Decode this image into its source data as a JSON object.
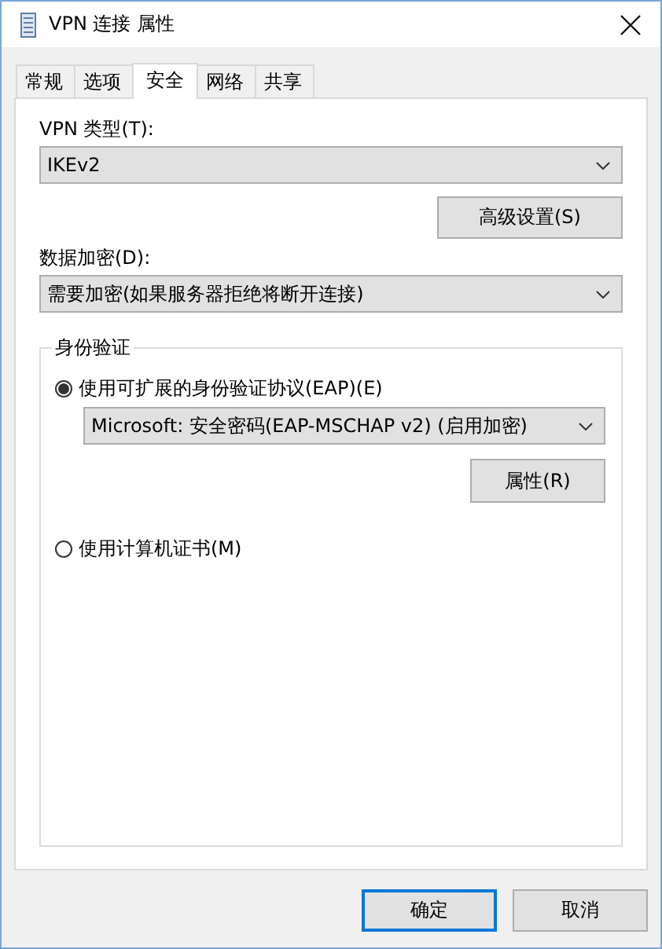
{
  "window": {
    "title": "VPN 连接 属性"
  },
  "tabs": [
    {
      "label": "常规",
      "selected": false
    },
    {
      "label": "选项",
      "selected": false
    },
    {
      "label": "安全",
      "selected": true
    },
    {
      "label": "网络",
      "selected": false
    },
    {
      "label": "共享",
      "selected": false
    }
  ],
  "vpn_type": {
    "label": "VPN 类型(T):",
    "value": "IKEv2"
  },
  "advanced_button": "高级设置(S)",
  "encryption": {
    "label": "数据加密(D):",
    "value": "需要加密(如果服务器拒绝将断开连接)"
  },
  "authentication": {
    "title": "身份验证",
    "options": [
      {
        "label": "使用可扩展的身份验证协议(EAP)(E)",
        "selected": true,
        "method": "Microsoft: 安全密码(EAP-MSCHAP v2) (启用加密)",
        "properties_button": "属性(R)"
      },
      {
        "label": "使用计算机证书(M)",
        "selected": false
      }
    ]
  },
  "buttons": [
    {
      "label": "确定",
      "default": true
    },
    {
      "label": "取消",
      "default": false
    }
  ]
}
